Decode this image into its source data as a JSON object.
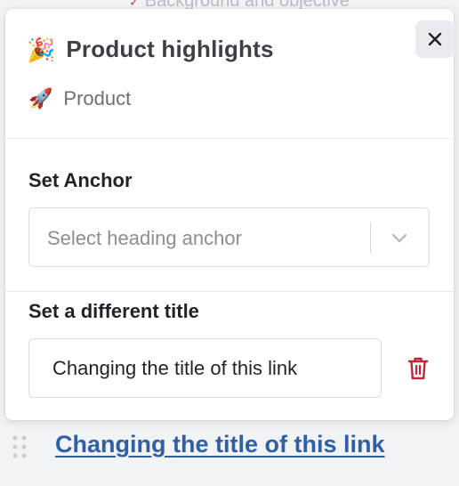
{
  "background": {
    "clipped_heading": "Background and objective"
  },
  "popover": {
    "title_emoji": "🎉",
    "title": "Product highlights",
    "subtitle_emoji": "🚀",
    "subtitle": "Product",
    "close_icon": "close-icon"
  },
  "anchor_section": {
    "label": "Set Anchor",
    "select_placeholder": "Select heading anchor",
    "chevron_icon": "chevron-down-icon"
  },
  "title_section": {
    "label": "Set a different title",
    "input_value": "Changing the title of this link",
    "delete_icon": "trash-icon",
    "delete_color": "#c0283a"
  },
  "editor": {
    "link_text": "Changing the title of this link",
    "link_color": "#2f5fa7",
    "drag_icon": "drag-handle-icon"
  }
}
